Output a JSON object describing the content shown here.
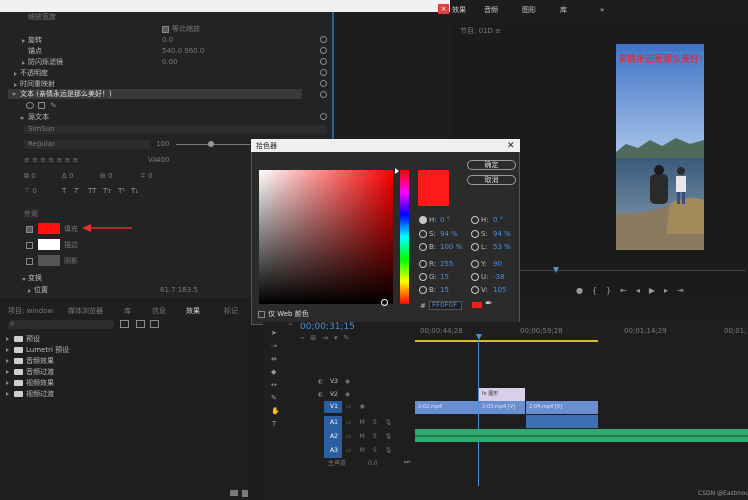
{
  "top_tabs": [
    "效果",
    "音频",
    "图形",
    "库",
    "»"
  ],
  "effect_controls": {
    "top_rows": [
      {
        "label": "缩放宽度",
        "value": ""
      },
      {
        "label": "",
        "value": "等比缩放"
      },
      {
        "label": "旋转",
        "value": "0.0"
      },
      {
        "label": "锚点",
        "value": "540.0    960.0"
      },
      {
        "label": "防闪烁滤镜",
        "value": "0.00"
      },
      {
        "label": "不透明度",
        "value": ""
      },
      {
        "label": "时间重映射",
        "value": ""
      }
    ],
    "text_layer": "文本 (亲情永远是那么美好！)",
    "source_text": "源文本",
    "font_name": "SimSun",
    "font_style": "Regular",
    "font_size": "100",
    "tracking": "400",
    "text_style_buttons": [
      "T",
      "T",
      "TT",
      "Tт",
      "T¹",
      "T₁"
    ],
    "appearance_title": "外观",
    "fill_label": "填充",
    "stroke_label": "描边",
    "shadow_label": "阴影",
    "transform_label": "变换",
    "position_label": "位置",
    "position_value": "61.7    183.5",
    "fill_color": "#ff0f0f"
  },
  "color_picker": {
    "title": "拾色器",
    "ok": "确定",
    "cancel": "取消",
    "web_only": "仅 Web 颜色",
    "hex_label": "#",
    "hex": "FF0F0F",
    "fields_left": [
      {
        "label": "H:",
        "value": "0 °"
      },
      {
        "label": "S:",
        "value": "94 %"
      },
      {
        "label": "B:",
        "value": "100 %"
      },
      {
        "label": "R:",
        "value": "255"
      },
      {
        "label": "G:",
        "value": "15"
      },
      {
        "label": "B:",
        "value": "15"
      }
    ],
    "fields_right": [
      {
        "label": "H:",
        "value": "0 °"
      },
      {
        "label": "S:",
        "value": "94 %"
      },
      {
        "label": "L:",
        "value": "53 %"
      },
      {
        "label": "Y:",
        "value": "90"
      },
      {
        "label": "U:",
        "value": "-38"
      },
      {
        "label": "V:",
        "value": "105"
      }
    ],
    "swatch_color": "#ff1a1a"
  },
  "program_monitor": {
    "header": "节目: 01D   ≡",
    "overlay_text": "亲情永远是那么美好！"
  },
  "project_panel": {
    "tabs": [
      "项目: window",
      "媒体浏览器",
      "库",
      "信息",
      "效果",
      "标记"
    ],
    "items": [
      "预设",
      "Lumetri 预设",
      "音频效果",
      "音频过渡",
      "视频效果",
      "视频过渡"
    ]
  },
  "timeline": {
    "timecode": "00;00;31;15",
    "ruler": [
      "00;00;44;28",
      "00;00;59;28",
      "00;01;14;29",
      "00;01;"
    ],
    "tracks_video": [
      "V3",
      "V2",
      "V1"
    ],
    "tracks_audio": [
      "A1",
      "A2",
      "A3"
    ],
    "master": "主声道",
    "master_value": "0.0",
    "clips": {
      "graphic": "图形",
      "v1a": "2-02.mp4",
      "v1b": "2-03.mp4 [V]",
      "v1c": "2-04.mp4 [V]"
    }
  },
  "watermark": "CSDN @Eastmount"
}
